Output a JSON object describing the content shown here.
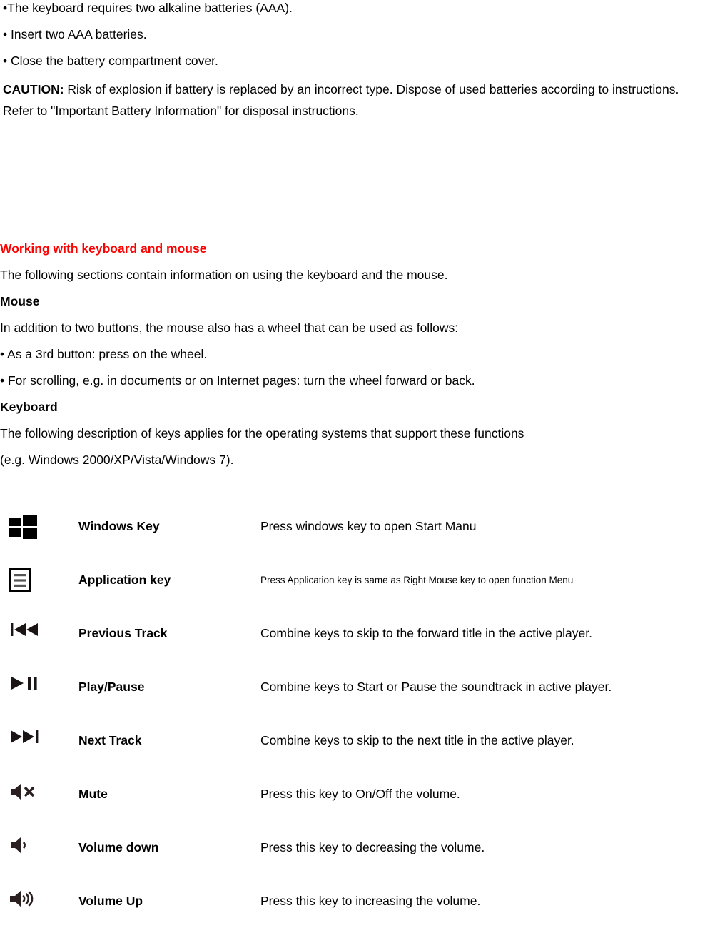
{
  "battery": {
    "bullets": [
      "•The keyboard requires two alkaline batteries (AAA).",
      "• Insert two AAA batteries.",
      "• Close the battery compartment cover."
    ],
    "caution_label": "CAUTION:",
    "caution_text": " Risk of explosion if battery is replaced by an incorrect type. Dispose of used batteries according to instructions.",
    "refer_line": "Refer to \"Important Battery Information\" for disposal instructions."
  },
  "section": {
    "title": "Working with keyboard and mouse",
    "title_color": "#ff0000",
    "intro": "The following sections contain information on using the keyboard and the mouse.",
    "mouse_heading": "Mouse",
    "mouse_intro": "In addition to two buttons, the mouse also has a wheel that can be used as follows:",
    "mouse_bullets": [
      "• As a 3rd button: press on the wheel.",
      "• For scrolling, e.g. in documents or on Internet pages: turn the wheel forward or back."
    ],
    "keyboard_heading": "Keyboard",
    "keyboard_intro_line1": "The following description of keys applies for the operating systems that support these functions",
    "keyboard_intro_line2": "(e.g. Windows 2000/XP/Vista/Windows 7)."
  },
  "key_table": {
    "rows": [
      {
        "icon": "windows-logo-icon",
        "label": "Windows Key",
        "description": "Press windows key to open Start Manu",
        "small": false
      },
      {
        "icon": "application-key-icon",
        "label": "Application key",
        "description": "Press Application key is same as Right Mouse key to open function Menu",
        "small": true
      },
      {
        "icon": "previous-track-icon",
        "label": "Previous Track",
        "description": "Combine keys to skip to the forward title in the active player.",
        "small": false
      },
      {
        "icon": "play-pause-icon",
        "label": "Play/Pause",
        "description": "Combine keys to Start or Pause the soundtrack in active player.",
        "small": false
      },
      {
        "icon": "next-track-icon",
        "label": "Next Track",
        "description": "Combine keys to skip to the next title in the active player.",
        "small": false
      },
      {
        "icon": "mute-icon",
        "label": "Mute",
        "description": "Press this key to On/Off the volume.",
        "small": false
      },
      {
        "icon": "volume-down-icon",
        "label": "Volume down",
        "description": "Press this key to decreasing the volume.",
        "small": false
      },
      {
        "icon": "volume-up-icon",
        "label": "Volume Up",
        "description": "Press this key to increasing the volume.",
        "small": false
      }
    ]
  }
}
